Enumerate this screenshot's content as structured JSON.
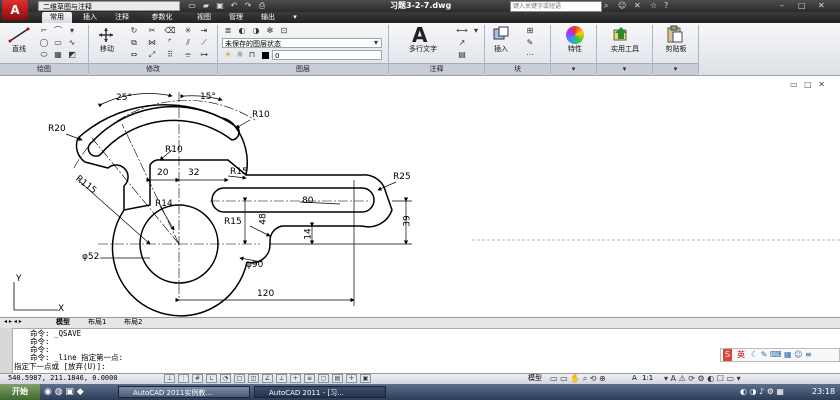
{
  "title_bar": {
    "logo": "A",
    "workspace": "二维草图与注释",
    "doc_title": "习题3-2-7.dwg",
    "search_placeholder": "键入关键字或短语"
  },
  "ribbon_tabs": [
    "常用",
    "插入",
    "注释",
    "参数化",
    "视图",
    "管理",
    "输出"
  ],
  "ribbon": {
    "draw_panel": {
      "line_label": "直线",
      "title": "绘图"
    },
    "modify_panel": {
      "move_label": "移动",
      "title": "修改"
    },
    "layer_panel": {
      "layer_state": "未保存的图层状态",
      "current_layer": "0",
      "title": "图层"
    },
    "annotation_panel": {
      "mtext_label": "多行文字",
      "title": "注释"
    },
    "block_panel": {
      "insert_label": "插入",
      "title": "块"
    },
    "properties_label": "特性",
    "utilities_label": "实用工具",
    "clipboard_label": "剪贴板"
  },
  "dimensions": [
    "25°",
    "15°",
    "R10",
    "R20",
    "R10",
    "R115",
    "20",
    "32",
    "R15",
    "R25",
    "R14",
    "80",
    "R15",
    "48",
    "14",
    "39",
    "φ52",
    "φ90",
    "120"
  ],
  "ucs": {
    "y": "Y",
    "x": "X"
  },
  "layout_tabs": [
    "模型",
    "布局1",
    "布局2"
  ],
  "command_lines": [
    "命令: _QSAVE",
    "命令:",
    "命令:",
    "命令: _line 指定第一点:",
    "指定下一点或 [放弃(U)]:"
  ],
  "ime_label": "英",
  "status": {
    "coords": "540.5987, 211.1846, 0.0000",
    "model_label": "模型",
    "scale_label": "1:1"
  },
  "taskbar": {
    "start_label": "开始",
    "items": [
      "AutoCAD 2011实例教...",
      "AutoCAD 2011 - [习..."
    ],
    "clock": "23:18"
  },
  "colors": {
    "cad_red": "#cc1010",
    "ribbon_bg": "#e8ebef",
    "taskbar": "#3a4d6b"
  }
}
